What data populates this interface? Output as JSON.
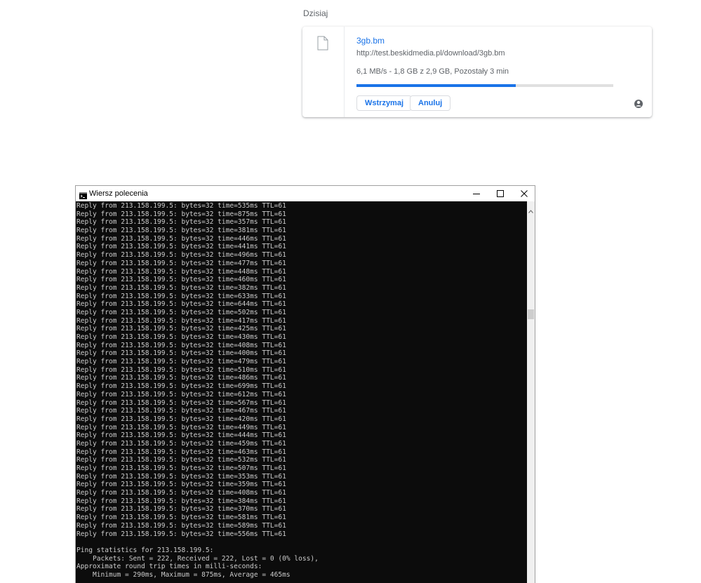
{
  "downloads": {
    "section_title": "Dzisiaj",
    "item": {
      "file_name": "3gb.bm",
      "url": "http://test.beskidmedia.pl/download/3gb.bm",
      "status": "6,1 MB/s - 1,8 GB z 2,9 GB, Pozostały 3 min",
      "progress_percent": 62,
      "pause_label": "Wstrzymaj",
      "cancel_label": "Anuluj",
      "file_icon": "file-icon",
      "more_icon": "more-icon"
    }
  },
  "cmd": {
    "title": "Wiersz polecenia",
    "lines": [
      "Reply from 213.158.199.5: bytes=32 time=535ms TTL=61",
      "Reply from 213.158.199.5: bytes=32 time=875ms TTL=61",
      "Reply from 213.158.199.5: bytes=32 time=357ms TTL=61",
      "Reply from 213.158.199.5: bytes=32 time=381ms TTL=61",
      "Reply from 213.158.199.5: bytes=32 time=446ms TTL=61",
      "Reply from 213.158.199.5: bytes=32 time=441ms TTL=61",
      "Reply from 213.158.199.5: bytes=32 time=496ms TTL=61",
      "Reply from 213.158.199.5: bytes=32 time=477ms TTL=61",
      "Reply from 213.158.199.5: bytes=32 time=448ms TTL=61",
      "Reply from 213.158.199.5: bytes=32 time=460ms TTL=61",
      "Reply from 213.158.199.5: bytes=32 time=382ms TTL=61",
      "Reply from 213.158.199.5: bytes=32 time=633ms TTL=61",
      "Reply from 213.158.199.5: bytes=32 time=644ms TTL=61",
      "Reply from 213.158.199.5: bytes=32 time=502ms TTL=61",
      "Reply from 213.158.199.5: bytes=32 time=417ms TTL=61",
      "Reply from 213.158.199.5: bytes=32 time=425ms TTL=61",
      "Reply from 213.158.199.5: bytes=32 time=430ms TTL=61",
      "Reply from 213.158.199.5: bytes=32 time=408ms TTL=61",
      "Reply from 213.158.199.5: bytes=32 time=400ms TTL=61",
      "Reply from 213.158.199.5: bytes=32 time=479ms TTL=61",
      "Reply from 213.158.199.5: bytes=32 time=510ms TTL=61",
      "Reply from 213.158.199.5: bytes=32 time=486ms TTL=61",
      "Reply from 213.158.199.5: bytes=32 time=699ms TTL=61",
      "Reply from 213.158.199.5: bytes=32 time=612ms TTL=61",
      "Reply from 213.158.199.5: bytes=32 time=567ms TTL=61",
      "Reply from 213.158.199.5: bytes=32 time=467ms TTL=61",
      "Reply from 213.158.199.5: bytes=32 time=420ms TTL=61",
      "Reply from 213.158.199.5: bytes=32 time=449ms TTL=61",
      "Reply from 213.158.199.5: bytes=32 time=444ms TTL=61",
      "Reply from 213.158.199.5: bytes=32 time=459ms TTL=61",
      "Reply from 213.158.199.5: bytes=32 time=463ms TTL=61",
      "Reply from 213.158.199.5: bytes=32 time=532ms TTL=61",
      "Reply from 213.158.199.5: bytes=32 time=507ms TTL=61",
      "Reply from 213.158.199.5: bytes=32 time=353ms TTL=61",
      "Reply from 213.158.199.5: bytes=32 time=359ms TTL=61",
      "Reply from 213.158.199.5: bytes=32 time=408ms TTL=61",
      "Reply from 213.158.199.5: bytes=32 time=384ms TTL=61",
      "Reply from 213.158.199.5: bytes=32 time=370ms TTL=61",
      "Reply from 213.158.199.5: bytes=32 time=581ms TTL=61",
      "Reply from 213.158.199.5: bytes=32 time=589ms TTL=61",
      "Reply from 213.158.199.5: bytes=32 time=556ms TTL=61",
      "",
      "Ping statistics for 213.158.199.5:",
      "    Packets: Sent = 222, Received = 222, Lost = 0 (0% loss),",
      "Approximate round trip times in milli-seconds:",
      "    Minimum = 290ms, Maximum = 875ms, Average = 465ms"
    ]
  }
}
